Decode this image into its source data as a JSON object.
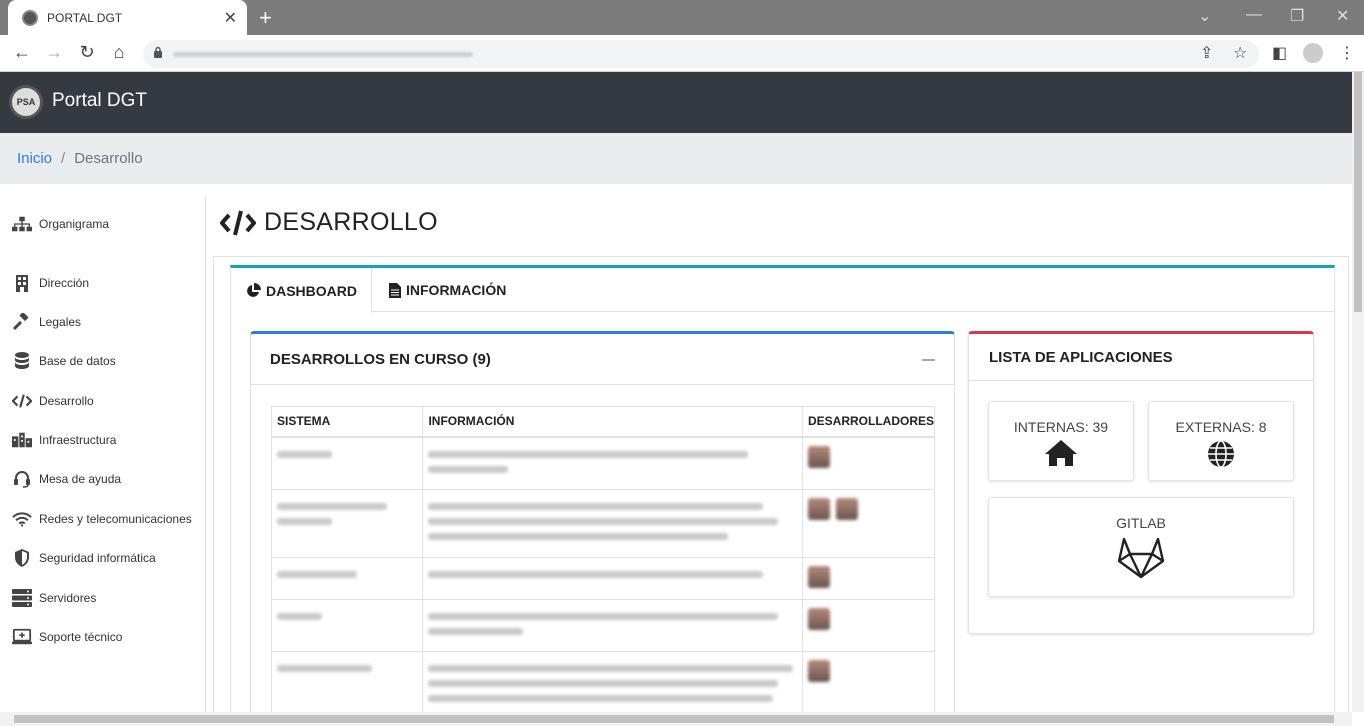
{
  "browser": {
    "tab_title": "PORTAL DGT",
    "close_tab": "✕",
    "new_tab": "+"
  },
  "header": {
    "logo_text": "PSA",
    "brand": "Portal DGT"
  },
  "breadcrumb": {
    "home": "Inicio",
    "separator": "/",
    "current": "Desarrollo"
  },
  "sidebar": {
    "items": [
      {
        "label": "Organigrama",
        "icon": "sitemap-icon"
      },
      {
        "label": "Dirección",
        "icon": "building-icon"
      },
      {
        "label": "Legales",
        "icon": "gavel-icon"
      },
      {
        "label": "Base de datos",
        "icon": "database-icon"
      },
      {
        "label": "Desarrollo",
        "icon": "code-icon"
      },
      {
        "label": "Infraestructura",
        "icon": "city-icon"
      },
      {
        "label": "Mesa de ayuda",
        "icon": "headset-icon"
      },
      {
        "label": "Redes y telecomunicaciones",
        "icon": "wifi-icon"
      },
      {
        "label": "Seguridad informática",
        "icon": "shield-icon"
      },
      {
        "label": "Servidores",
        "icon": "server-icon"
      },
      {
        "label": "Soporte técnico",
        "icon": "laptop-icon"
      }
    ]
  },
  "main": {
    "title": "DESARROLLO",
    "tabs": [
      {
        "label": "DASHBOARD",
        "icon": "chart-pie-icon"
      },
      {
        "label": "INFORMACIÓN",
        "icon": "file-icon"
      }
    ],
    "developments": {
      "title": "DESARROLLOS EN CURSO (9)",
      "columns": [
        "SISTEMA",
        "INFORMACIÓN",
        "DESARROLLADORES"
      ]
    },
    "apps": {
      "title": "LISTA DE APLICACIONES",
      "internal": "INTERNAS: 39",
      "external": "EXTERNAS: 8",
      "gitlab": "GITLAB"
    }
  },
  "colors": {
    "header_bg": "#343a40",
    "tabs_accent": "#17a2b8",
    "dev_accent": "#2c7be5",
    "apps_accent": "#dc3545"
  }
}
